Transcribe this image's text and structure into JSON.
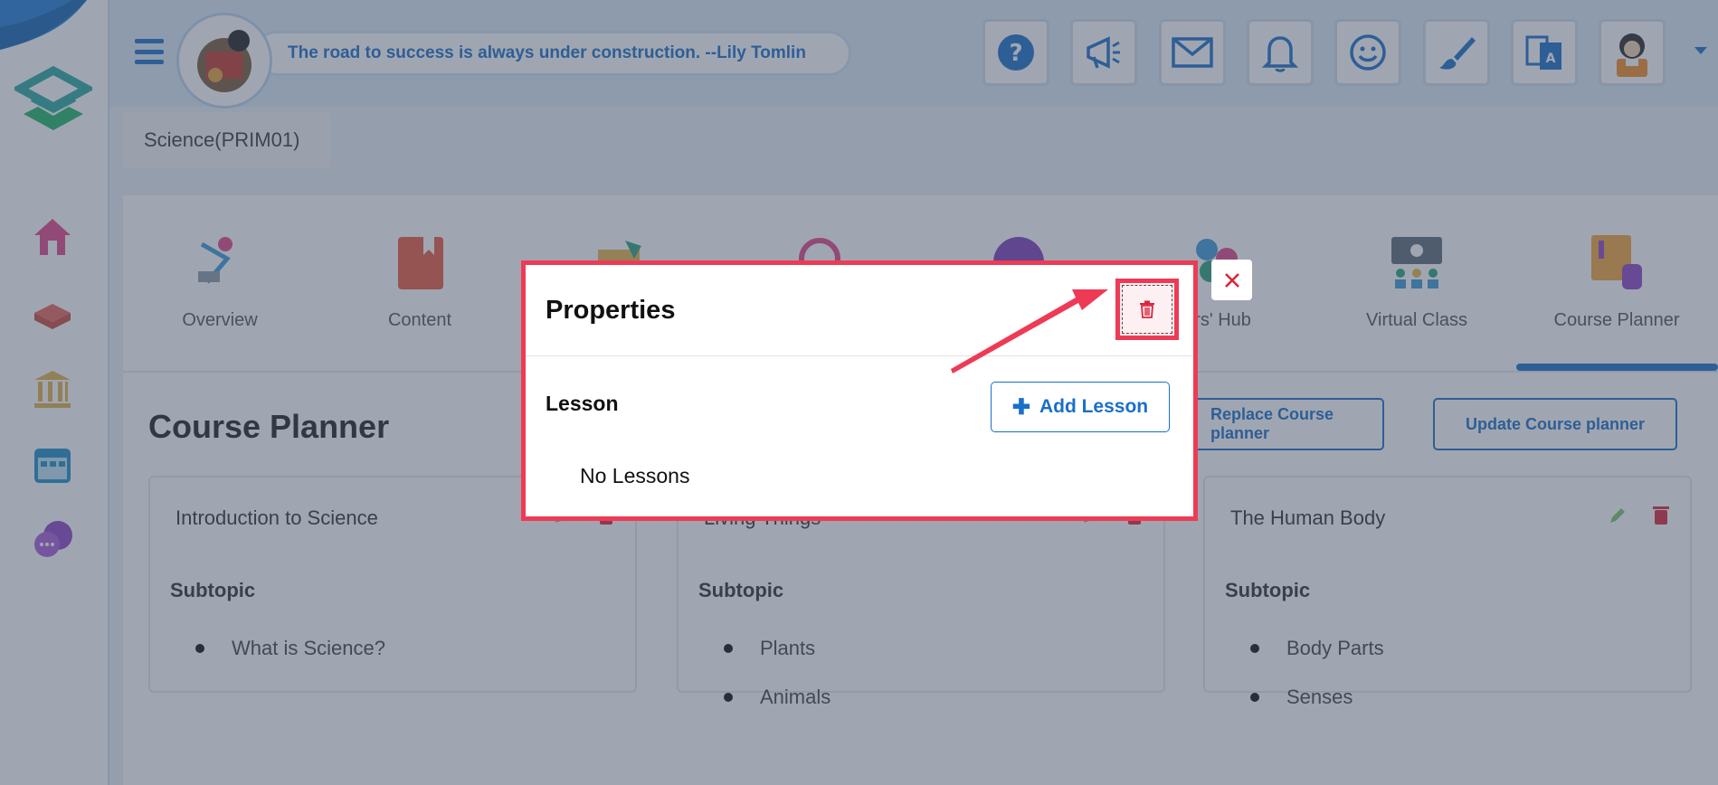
{
  "header": {
    "quote": "The road to success is always under construction. --Lily Tomlin",
    "buttons": [
      "help-icon",
      "megaphone-icon",
      "mail-icon",
      "bell-icon",
      "smiley-icon",
      "brush-icon",
      "translate-icon",
      "user-avatar-icon"
    ]
  },
  "course": {
    "name": "Science(PRIM01)"
  },
  "sidebar": {
    "items": [
      "home-icon",
      "book-icon",
      "institution-icon",
      "calendar-icon",
      "chat-icon"
    ]
  },
  "tabs": [
    {
      "label": "Overview",
      "icon": "overview-icon"
    },
    {
      "label": "Content",
      "icon": "content-icon"
    },
    {
      "label": "",
      "icon": "notes-icon"
    },
    {
      "label": "",
      "icon": "search-icon"
    },
    {
      "label": "",
      "icon": "circle-icon"
    },
    {
      "label": "ers' Hub",
      "icon": "hub-icon"
    },
    {
      "label": "Virtual Class",
      "icon": "virtual-class-icon"
    },
    {
      "label": "Course Planner",
      "icon": "course-planner-icon"
    }
  ],
  "planner": {
    "title": "Course Planner",
    "replace_label": "Replace Course planner",
    "update_label": "Update Course planner",
    "cards": [
      {
        "title": "Introduction to Science",
        "subtopic_label": "Subtopic",
        "items": [
          "What is Science?"
        ]
      },
      {
        "title": "Living Things",
        "subtopic_label": "Subtopic",
        "items": [
          "Plants",
          "Animals"
        ]
      },
      {
        "title": "The Human Body",
        "subtopic_label": "Subtopic",
        "items": [
          "Body Parts",
          "Senses"
        ]
      }
    ]
  },
  "modal": {
    "title": "Properties",
    "lesson_label": "Lesson",
    "add_lesson_label": "Add Lesson",
    "no_lessons": "No Lessons"
  },
  "colors": {
    "accent": "#1a6fc9",
    "highlight": "#ee3b55",
    "danger": "#d9263c"
  }
}
